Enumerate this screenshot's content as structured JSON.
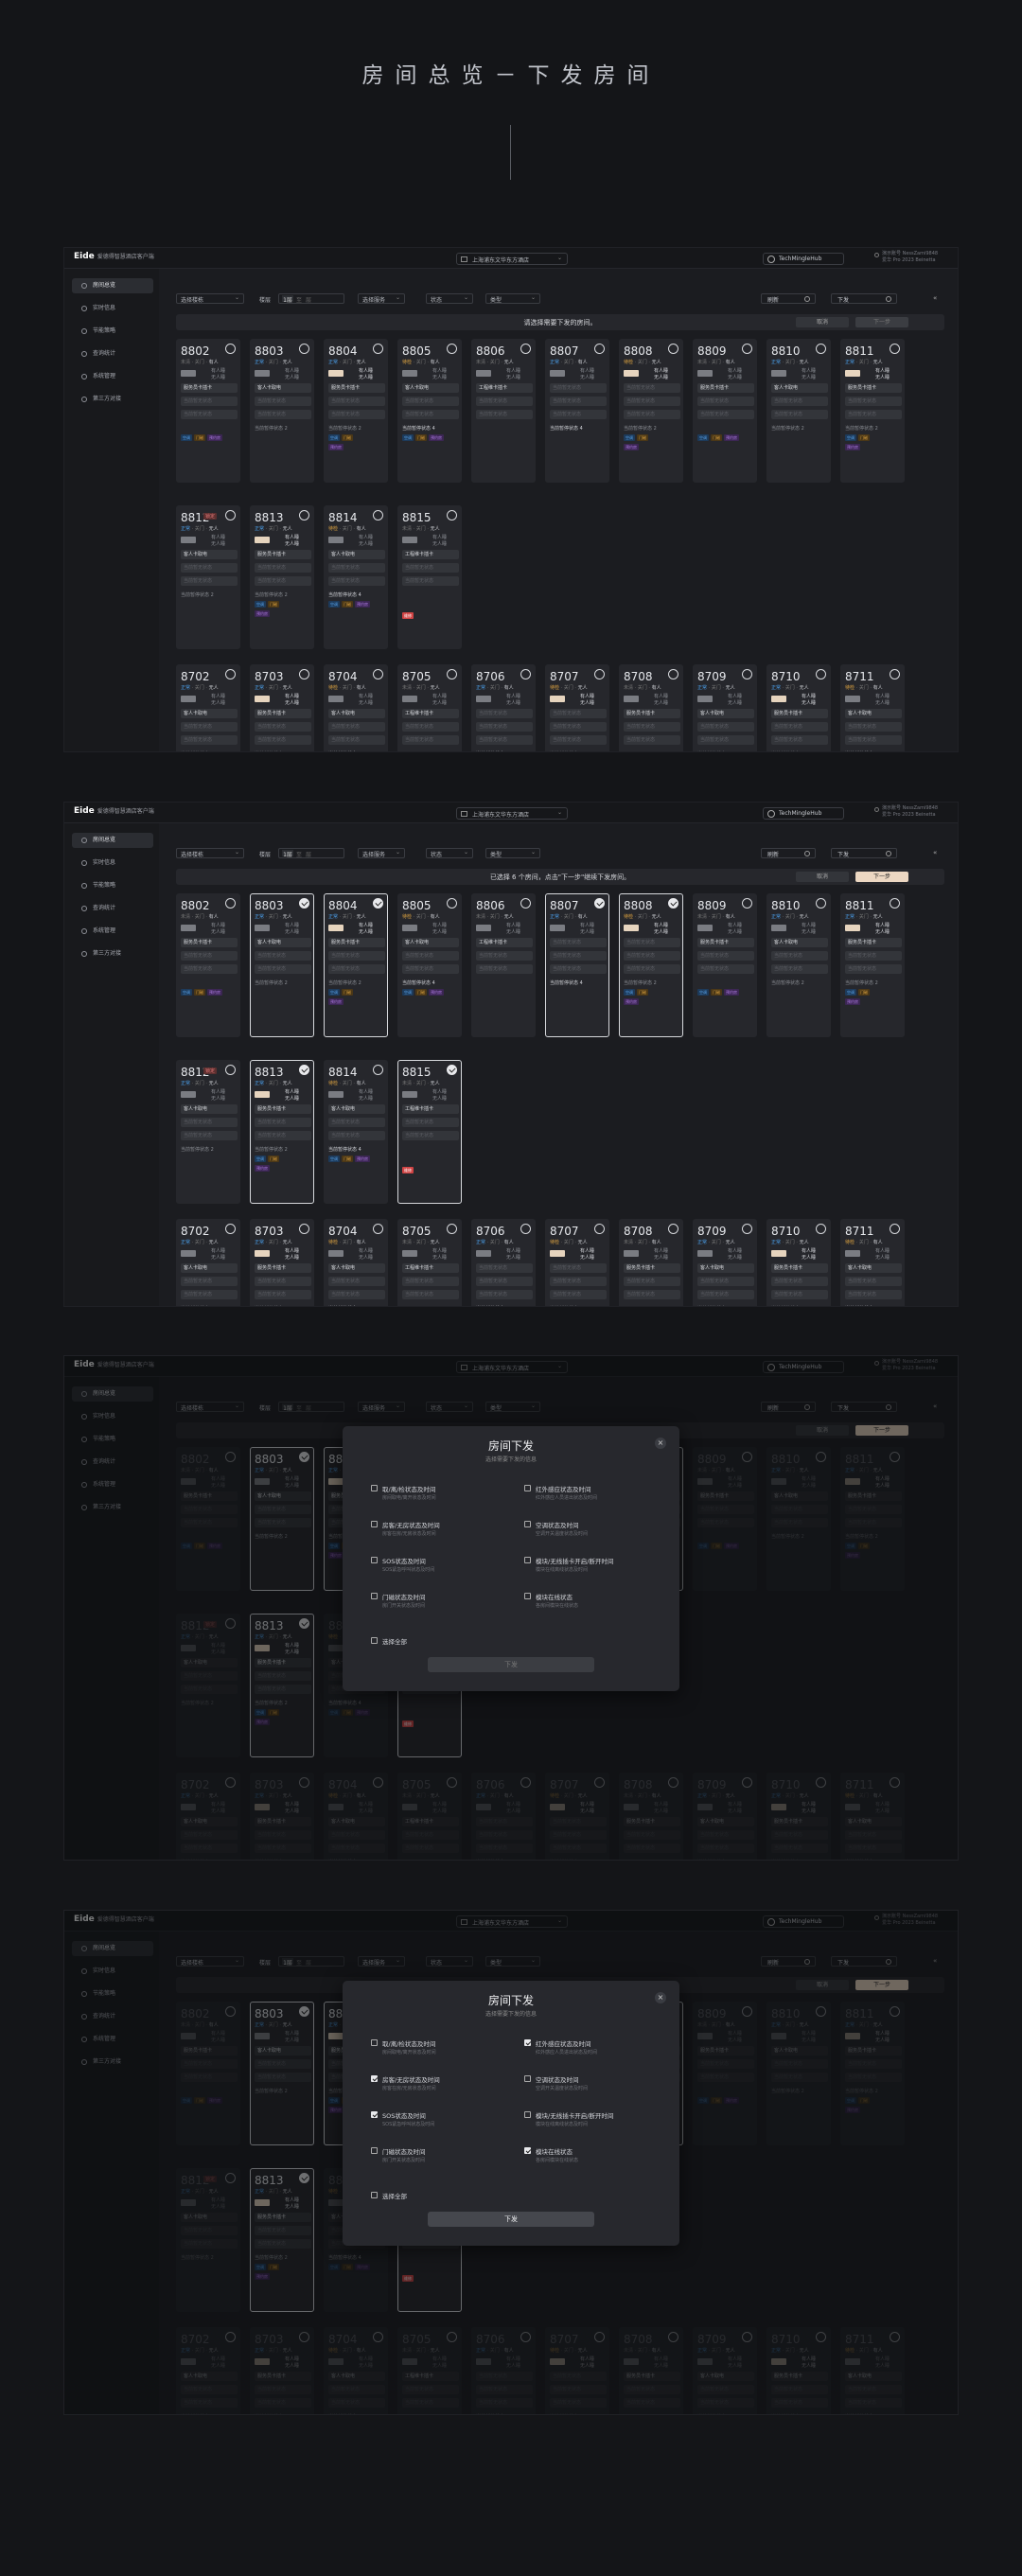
{
  "hero_title": "房间总览－下发房间",
  "app": {
    "logo": "Eide",
    "company": "爱德得智慧酒店客户端",
    "hotel": "上海浦东文华东方酒店",
    "user": "TechMingleHub",
    "account": "演示账号 NessZami9848",
    "account2": "爱华 Pro 2023 Beinetta"
  },
  "nav": [
    "房间总览",
    "实时信息",
    "节能策略",
    "查询统计",
    "系统管理",
    "第三方对接"
  ],
  "filters": {
    "building": "选择楼栋",
    "floor_label": "楼层",
    "floor_from": "1层",
    "floor_sep": "至",
    "floor_to": "层",
    "service": "选择服务",
    "status": "状态",
    "type": "类型",
    "refresh": "刷新",
    "send": "下发",
    "collapse": "«"
  },
  "banner": {
    "hint1": "请选择需要下发的房间。",
    "hint2": "已选择 6 个房间，点击\"下一步\"继续下发房间。",
    "cancel": "取消",
    "next": "下一步"
  },
  "statuses": {
    "s0": "正常",
    "s1": "待检",
    "s2": "未清",
    "door": "开门",
    "door2": "关门",
    "occ": "有人",
    "occ2": "无人"
  },
  "row_labels": {
    "empty": "当前暂无状态",
    "rent": "服务员卡插卡",
    "guest": "客人卡取电",
    "clean": "工程维卡插卡",
    "settle": "客人卡插卡",
    "work": "无卡取电",
    "power": "取电中",
    "sleep": "房客维修中",
    "bed": "床头",
    "total": "当前暂停状态 4",
    "total3": "当前暂停状态 3",
    "total1": "当前暂停状态 1",
    "total2": "当前暂停状态 2",
    "d1": "有人睡",
    "d2": "无人睡",
    "d3": "门磁"
  },
  "tags": {
    "t1": "空调",
    "t2": "门磁",
    "t3": "灯光",
    "t4": "窗帘",
    "t5": "离线",
    "t6": "门铃",
    "t7": "预约房",
    "t8": "维修"
  },
  "rooms1": [
    "8802",
    "8803",
    "8804",
    "8805",
    "8806",
    "8807",
    "8808",
    "8809",
    "8810",
    "8811"
  ],
  "rooms2": [
    "8812",
    "8813",
    "8814",
    "8815"
  ],
  "rooms3": [
    "8702",
    "8703",
    "8704",
    "8705",
    "8706",
    "8707",
    "8708",
    "8709",
    "8710",
    "8711"
  ],
  "badge": "锁定",
  "modal": {
    "title": "房间下发",
    "subtitle": "选择需要下发的信息",
    "options": [
      {
        "label": "取/离/检状态及时间",
        "desc": "房间取电/离开状态及时间"
      },
      {
        "label": "红外感应状态及时间",
        "desc": "红外感应人员进出状态及时间"
      },
      {
        "label": "房客/无房状态及时间",
        "desc": "房客在房/无房状态及时间"
      },
      {
        "label": "空调状态及时间",
        "desc": "空调开关温度状态及时间"
      },
      {
        "label": "SOS状态及时间",
        "desc": "SOS紧急呼叫状态及时间"
      },
      {
        "label": "模块/无线插卡开启/断开时间",
        "desc": "模块在线离线状态及时间"
      },
      {
        "label": "门磁状态及时间",
        "desc": "房门开关状态及时间"
      },
      {
        "label": "模块在线状态",
        "desc": "各房间模块在线状态"
      }
    ],
    "select_all": "选择全部",
    "submit": "下发",
    "close": "×"
  }
}
